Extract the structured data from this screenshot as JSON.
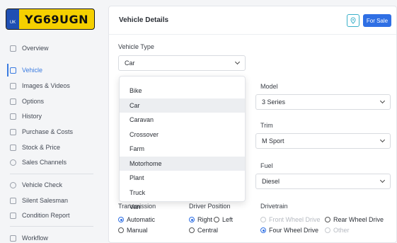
{
  "plate": {
    "country": "UK",
    "registration": "YG69UGN"
  },
  "sidebar": {
    "items": [
      {
        "label": "Overview",
        "icon": "home-icon"
      },
      {
        "label": "Vehicle",
        "icon": "car-icon"
      },
      {
        "label": "Images & Videos",
        "icon": "image-icon"
      },
      {
        "label": "Options",
        "icon": "list-icon"
      },
      {
        "label": "History",
        "icon": "calendar-icon"
      },
      {
        "label": "Purchase & Costs",
        "icon": "receipt-icon"
      },
      {
        "label": "Stock & Price",
        "icon": "tag-icon"
      },
      {
        "label": "Sales Channels",
        "icon": "broadcast-icon"
      },
      {
        "label": "Vehicle Check",
        "icon": "search-icon"
      },
      {
        "label": "Silent Salesman",
        "icon": "document-icon"
      },
      {
        "label": "Condition Report",
        "icon": "report-icon"
      },
      {
        "label": "Workflow",
        "icon": "workflow-icon"
      }
    ],
    "active": "Vehicle"
  },
  "header": {
    "title": "Vehicle Details",
    "for_sale_label": "For Sale"
  },
  "form": {
    "vehicle_type_label": "Vehicle Type",
    "vehicle_type_value": "Car",
    "model_label": "Model",
    "model_value": "3 Series",
    "trim_label": "Trim",
    "trim_value": "M Sport",
    "fuel_label": "Fuel",
    "fuel_value": "Diesel",
    "transmission_label": "Transmission",
    "transmission_options": [
      "Automatic",
      "Manual"
    ],
    "driver_position_label": "Driver Position",
    "driver_position_options": [
      "Right",
      "Left",
      "Central"
    ],
    "drivetrain_label": "Drivetrain",
    "drivetrain_options": [
      "Front Wheel Drive",
      "Rear Wheel Drive",
      "Four Wheel Drive",
      "Other"
    ]
  },
  "dropdown": {
    "options": [
      "Bike",
      "Car",
      "Caravan",
      "Crossover",
      "Farm",
      "Motorhome",
      "Plant",
      "Truck",
      "Van"
    ]
  },
  "colors": {
    "accent": "#2f6fe4",
    "plate_yellow": "#f5d000",
    "plate_blue": "#1f4fb3"
  }
}
